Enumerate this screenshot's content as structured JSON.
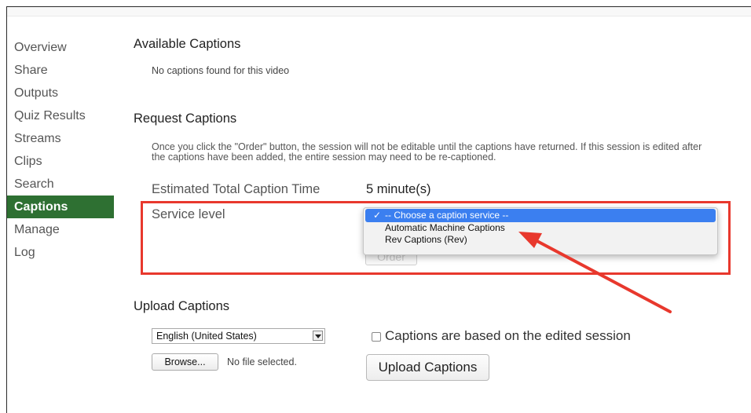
{
  "sidebar": {
    "items": [
      {
        "label": "Overview"
      },
      {
        "label": "Share"
      },
      {
        "label": "Outputs"
      },
      {
        "label": "Quiz Results"
      },
      {
        "label": "Streams"
      },
      {
        "label": "Clips"
      },
      {
        "label": "Search"
      },
      {
        "label": "Captions"
      },
      {
        "label": "Manage"
      },
      {
        "label": "Log"
      }
    ],
    "active_label": "Captions"
  },
  "available": {
    "title": "Available Captions",
    "empty_text": "No captions found for this video"
  },
  "request": {
    "title": "Request Captions",
    "description": "Once you click the \"Order\" button, the session will not be editable until the captions have returned. If this session is edited after the captions have been added, the entire session may need to be re-captioned.",
    "estimate_label": "Estimated Total Caption Time",
    "estimate_value": "5 minute(s)",
    "service_label": "Service level",
    "order_button": "Order",
    "options": [
      {
        "label": "-- Choose a caption service --",
        "selected": true
      },
      {
        "label": "Automatic Machine Captions",
        "selected": false
      },
      {
        "label": "Rev Captions (Rev)",
        "selected": false
      }
    ]
  },
  "upload": {
    "title": "Upload Captions",
    "language_value": "English (United States)",
    "browse_button": "Browse...",
    "no_file_text": "No file selected.",
    "edited_checkbox_label": "Captions are based on the edited session",
    "edited_checked": false,
    "upload_button": "Upload Captions"
  },
  "colors": {
    "active_nav_bg": "#2e7032",
    "highlight_red": "#e8382d",
    "selected_option_bg": "#3b7ff0"
  }
}
